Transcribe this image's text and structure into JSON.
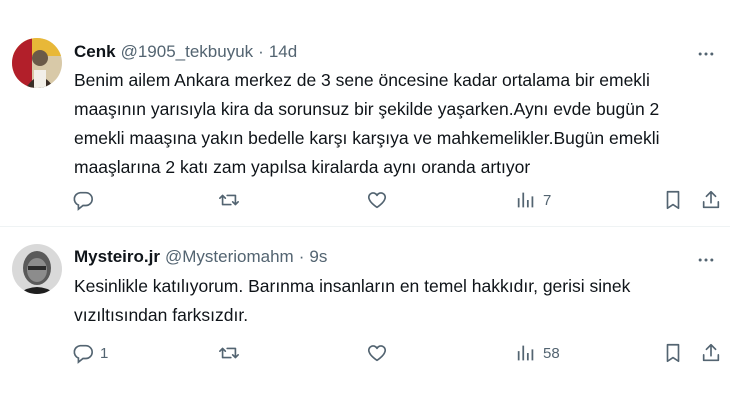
{
  "tweets": [
    {
      "name": "Cenk",
      "handle": "@1905_tekbuyuk",
      "separator": "·",
      "time": "14d",
      "text_lines": [
        "Benim ailem Ankara merkez de 3 sene öncesine kadar ortalama bir emekli",
        "maaşının  yarısıyla kira da sorunsuz bir şekilde yaşarken.Aynı evde  bugün 2",
        "emekli maaşına yakın bedelle karşı karşıya ve mahkemelikler.Bugün emekli",
        "maaşlarına 2 katı zam yapılsa kiralarda aynı oranda artıyor"
      ],
      "actions": {
        "reply": "",
        "retweet": "",
        "like": "",
        "views": "7"
      }
    },
    {
      "name": "Mysteiro.jr",
      "handle": "@Mysteriomahm",
      "separator": "·",
      "time": "9s",
      "text_lines": [
        "Kesinlikle katılıyorum. Barınma insanların en  temel hakkıdır,  gerisi sinek",
        "vızıltısından farksızdır."
      ],
      "actions": {
        "reply": "1",
        "retweet": "",
        "like": "",
        "views": "58"
      }
    }
  ],
  "icons": {
    "reply": "reply-icon",
    "retweet": "retweet-icon",
    "like": "like-icon",
    "views": "views-icon",
    "bookmark": "bookmark-icon",
    "share": "share-icon",
    "more": "more-icon"
  },
  "colors": {
    "text": "#0f1419",
    "secondary": "#536471",
    "divider": "#eff3f4"
  }
}
